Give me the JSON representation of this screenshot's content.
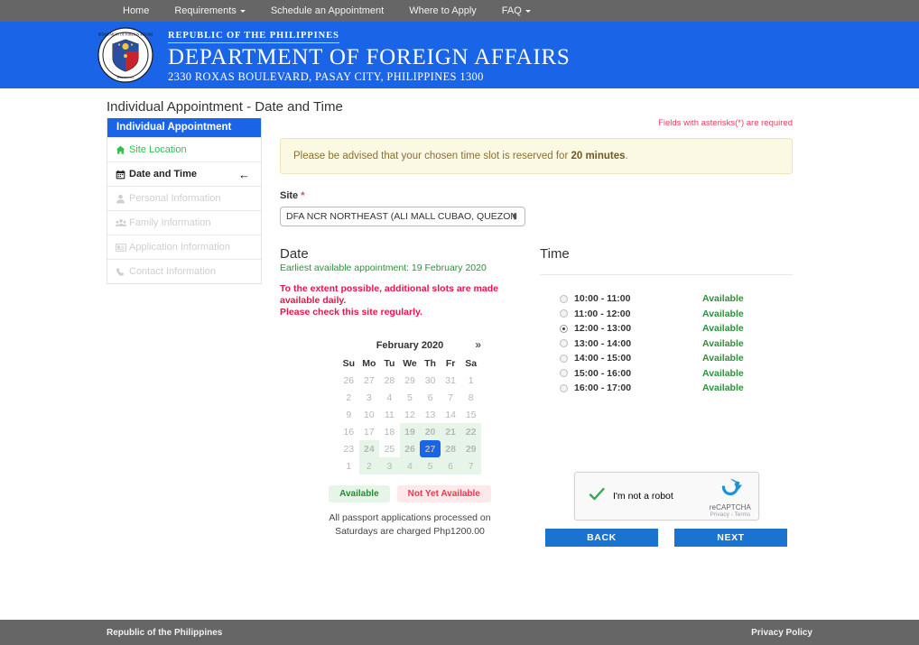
{
  "topnav": {
    "items": [
      {
        "label": "Home",
        "caret": false
      },
      {
        "label": "Requirements",
        "caret": true
      },
      {
        "label": "Schedule an Appointment",
        "caret": false
      },
      {
        "label": "Where to Apply",
        "caret": false
      },
      {
        "label": "FAQ",
        "caret": true
      }
    ]
  },
  "banner": {
    "line1": "REPUBLIC OF THE PHILIPPINES",
    "line2": "DEPARTMENT OF FOREIGN AFFAIRS",
    "line3": "2330 ROXAS BOULEVARD, PASAY CITY, PHILIPPINES 1300",
    "seal_name": "dfa-seal",
    "bg_color": "#1a64e8"
  },
  "page_title": "Individual Appointment - Date and Time",
  "sidebar": {
    "header": "Individual Appointment",
    "items": [
      {
        "label": "Site Location",
        "icon": "home-icon",
        "state": "done"
      },
      {
        "label": "Date and Time",
        "icon": "calendar-icon",
        "state": "active",
        "arrow": "←"
      },
      {
        "label": "Personal Information",
        "icon": "user-icon",
        "state": "dim"
      },
      {
        "label": "Family Information",
        "icon": "users-icon",
        "state": "dim"
      },
      {
        "label": "Application Information",
        "icon": "id-card-icon",
        "state": "dim"
      },
      {
        "label": "Contact Information",
        "icon": "phone-icon",
        "state": "dim"
      }
    ]
  },
  "main": {
    "required_note": "Fields with asterisks(*) are required",
    "alert_prefix": "Please be advised that your chosen time slot is reserved for ",
    "alert_bold": "20 minutes",
    "alert_suffix": ".",
    "site_label": "Site",
    "site_asterisk": "*",
    "site_value": "DFA NCR NORTHEAST (ALI MALL CUBAO, QUEZON CITY)"
  },
  "date_section": {
    "heading": "Date",
    "earliest": "Earliest available appointment: 19 February 2020",
    "warning_line1": "To the extent possible, additional slots are made available daily.",
    "warning_line2": "Please check this site regularly.",
    "calendar": {
      "month_title": "February 2020",
      "next_label": "»",
      "weekdays": [
        "Su",
        "Mo",
        "Tu",
        "We",
        "Th",
        "Fr",
        "Sa"
      ],
      "weeks": [
        [
          {
            "d": "26",
            "s": "off"
          },
          {
            "d": "27",
            "s": "off"
          },
          {
            "d": "28",
            "s": "off"
          },
          {
            "d": "29",
            "s": "off"
          },
          {
            "d": "30",
            "s": "off"
          },
          {
            "d": "31",
            "s": "off"
          },
          {
            "d": "1",
            "s": "off"
          }
        ],
        [
          {
            "d": "2",
            "s": "off"
          },
          {
            "d": "3",
            "s": "off"
          },
          {
            "d": "4",
            "s": "off"
          },
          {
            "d": "5",
            "s": "off"
          },
          {
            "d": "6",
            "s": "off"
          },
          {
            "d": "7",
            "s": "off"
          },
          {
            "d": "8",
            "s": "off"
          }
        ],
        [
          {
            "d": "9",
            "s": "off"
          },
          {
            "d": "10",
            "s": "off"
          },
          {
            "d": "11",
            "s": "off"
          },
          {
            "d": "12",
            "s": "off"
          },
          {
            "d": "13",
            "s": "off"
          },
          {
            "d": "14",
            "s": "off"
          },
          {
            "d": "15",
            "s": "off"
          }
        ],
        [
          {
            "d": "16",
            "s": "off"
          },
          {
            "d": "17",
            "s": "off"
          },
          {
            "d": "18",
            "s": "off"
          },
          {
            "d": "19",
            "s": "avail"
          },
          {
            "d": "20",
            "s": "avail"
          },
          {
            "d": "21",
            "s": "avail"
          },
          {
            "d": "22",
            "s": "avail"
          }
        ],
        [
          {
            "d": "23",
            "s": "off"
          },
          {
            "d": "24",
            "s": "avail"
          },
          {
            "d": "25",
            "s": "off"
          },
          {
            "d": "26",
            "s": "avail"
          },
          {
            "d": "27",
            "s": "sel"
          },
          {
            "d": "28",
            "s": "avail"
          },
          {
            "d": "29",
            "s": "avail"
          }
        ],
        [
          {
            "d": "1",
            "s": "off"
          },
          {
            "d": "2",
            "s": "avail-muted"
          },
          {
            "d": "3",
            "s": "avail-muted"
          },
          {
            "d": "4",
            "s": "avail-muted"
          },
          {
            "d": "5",
            "s": "avail-muted"
          },
          {
            "d": "6",
            "s": "avail-muted"
          },
          {
            "d": "7",
            "s": "avail-muted"
          }
        ]
      ]
    },
    "legend": [
      {
        "label": "Available",
        "kind": "ok"
      },
      {
        "label": "Not Yet Available",
        "kind": "no"
      }
    ],
    "saturday_note_line1": "All passport applications processed on",
    "saturday_note_line2": "Saturdays are charged Php1200.00"
  },
  "time_section": {
    "heading": "Time",
    "slots": [
      {
        "label": "10:00 - 11:00",
        "status": "Available",
        "selected": false
      },
      {
        "label": "11:00 - 12:00",
        "status": "Available",
        "selected": false
      },
      {
        "label": "12:00 - 13:00",
        "status": "Available",
        "selected": true
      },
      {
        "label": "13:00 - 14:00",
        "status": "Available",
        "selected": false
      },
      {
        "label": "14:00 - 15:00",
        "status": "Available",
        "selected": false
      },
      {
        "label": "15:00 - 16:00",
        "status": "Available",
        "selected": false
      },
      {
        "label": "16:00 - 17:00",
        "status": "Available",
        "selected": false
      }
    ]
  },
  "captcha": {
    "label": "I'm not a robot",
    "brand": "reCAPTCHA",
    "sub": "Privacy - Terms",
    "checked": true
  },
  "buttons": {
    "back": "BACK",
    "next": "NEXT"
  },
  "footer": {
    "left": "Republic of the Philippines",
    "right": "Privacy Policy"
  },
  "colors": {
    "brand_blue": "#1a64e8",
    "button_blue": "#1a73cf",
    "nav_gray": "#666666",
    "green": "#2f8f3f",
    "red": "#e8144b",
    "alert_bg": "#fbf8e3"
  }
}
